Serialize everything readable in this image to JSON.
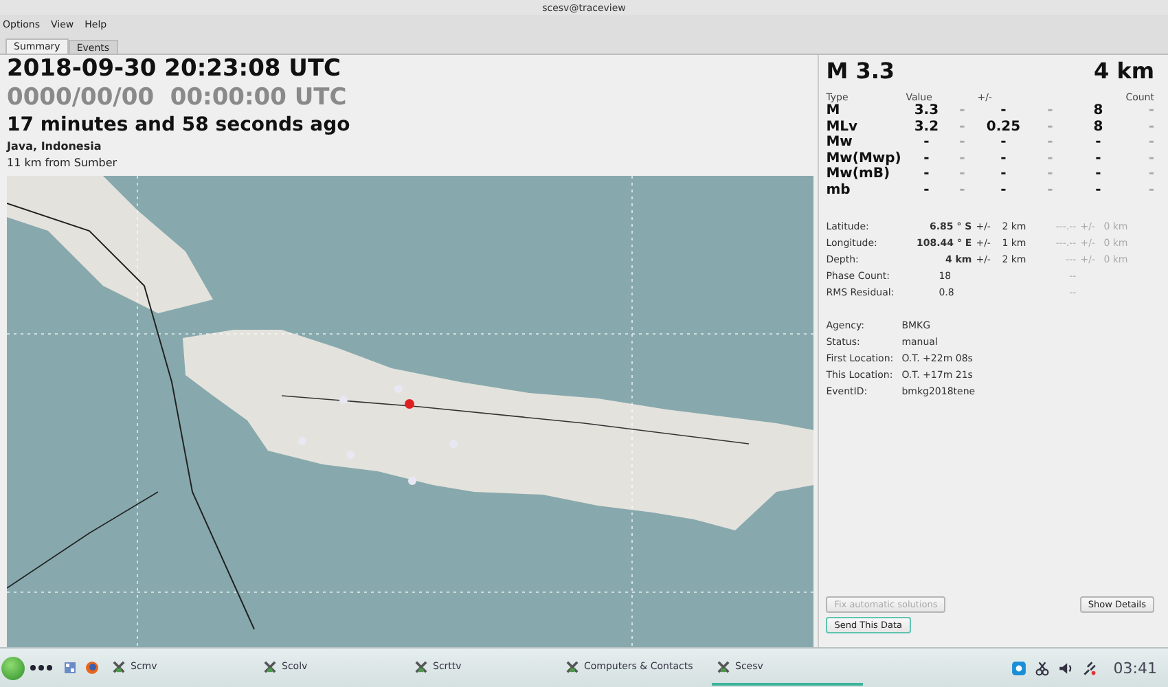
{
  "window": {
    "title": "scesv@traceview"
  },
  "menu": [
    "Options",
    "View",
    "Help"
  ],
  "tabs": [
    {
      "label": "Summary",
      "selected": true
    },
    {
      "label": "Events",
      "selected": false
    }
  ],
  "summary": {
    "origin_time": "2018-09-30 20:23:08 UTC",
    "second_time": "0000/00/00  00:00:00 UTC",
    "elapsed": "17 minutes and 58 seconds ago",
    "region": "Java, Indonesia",
    "nearest": "11 km from Sumber"
  },
  "magnitude": {
    "headline": "M 3.3",
    "depth": "4 km",
    "header": [
      "Type",
      "Value",
      "+/-",
      "Count"
    ],
    "rows": [
      [
        "M",
        "3.3",
        "-",
        "-",
        "-",
        "8",
        "-"
      ],
      [
        "MLv",
        "3.2",
        "-",
        "0.25",
        "-",
        "8",
        "-"
      ],
      [
        "Mw",
        "-",
        "-",
        "-",
        "-",
        "-",
        "-"
      ],
      [
        "Mw(Mwp)",
        "-",
        "-",
        "-",
        "-",
        "-",
        "-"
      ],
      [
        "Mw(mB)",
        "-",
        "-",
        "-",
        "-",
        "-",
        "-"
      ],
      [
        "mb",
        "-",
        "-",
        "-",
        "-",
        "-",
        "-"
      ]
    ]
  },
  "location": [
    {
      "label": "Latitude:",
      "value": "6.85 ° S",
      "pm": "+/-",
      "error": "2 km",
      "alt": "---.--",
      "alt_pm": "+/-",
      "alt_error": "0 km"
    },
    {
      "label": "Longitude:",
      "value": "108.44 ° E",
      "pm": "+/-",
      "error": "1 km",
      "alt": "---.--",
      "alt_pm": "+/-",
      "alt_error": "0 km"
    },
    {
      "label": "Depth:",
      "value": "4 km",
      "pm": "+/-",
      "error": "2 km",
      "alt": "---",
      "alt_pm": "+/-",
      "alt_error": "0 km"
    },
    {
      "label": "Phase Count:",
      "plain": "18",
      "alt": "--"
    },
    {
      "label": "RMS Residual:",
      "plain": "0.8",
      "alt": "--"
    }
  ],
  "info": [
    {
      "label": "Agency:",
      "value": "BMKG"
    },
    {
      "label": "Status:",
      "value": "manual"
    },
    {
      "label": "First Location:",
      "value": "O.T. +22m 08s"
    },
    {
      "label": "This Location:",
      "value": "O.T. +17m 21s"
    },
    {
      "label": "EventID:",
      "value": "bmkg2018tene"
    }
  ],
  "buttons": {
    "fix": {
      "label": "Fix automatic solutions",
      "disabled": true
    },
    "details": {
      "label": "Show Details"
    },
    "send": {
      "label": "Send This Data",
      "focused": true
    }
  },
  "taskbar": {
    "tasks": [
      {
        "label": "Scmv",
        "selected": false
      },
      {
        "label": "Scolv",
        "selected": false
      },
      {
        "label": "Scrttv",
        "selected": false
      },
      {
        "label": "Computers & Contacts",
        "selected": false
      },
      {
        "label": "Scesv",
        "selected": true
      }
    ],
    "clock": "03:41"
  }
}
